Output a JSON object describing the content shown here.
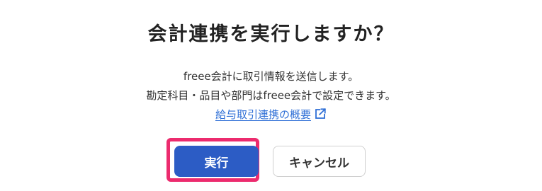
{
  "dialog": {
    "title": "会計連携を実行しますか？",
    "description_line1": "freee会計に取引情報を送信します。",
    "description_line2": "勘定科目・品目や部門はfreee会計で設定できます。",
    "link_text": "給与取引連携の概要",
    "link_icon": "external-link-icon",
    "execute_label": "実行",
    "cancel_label": "キャンセル"
  },
  "colors": {
    "primary": "#2c5cc5",
    "focus_ring": "#ec2b6e",
    "link": "#2f6fd6"
  }
}
